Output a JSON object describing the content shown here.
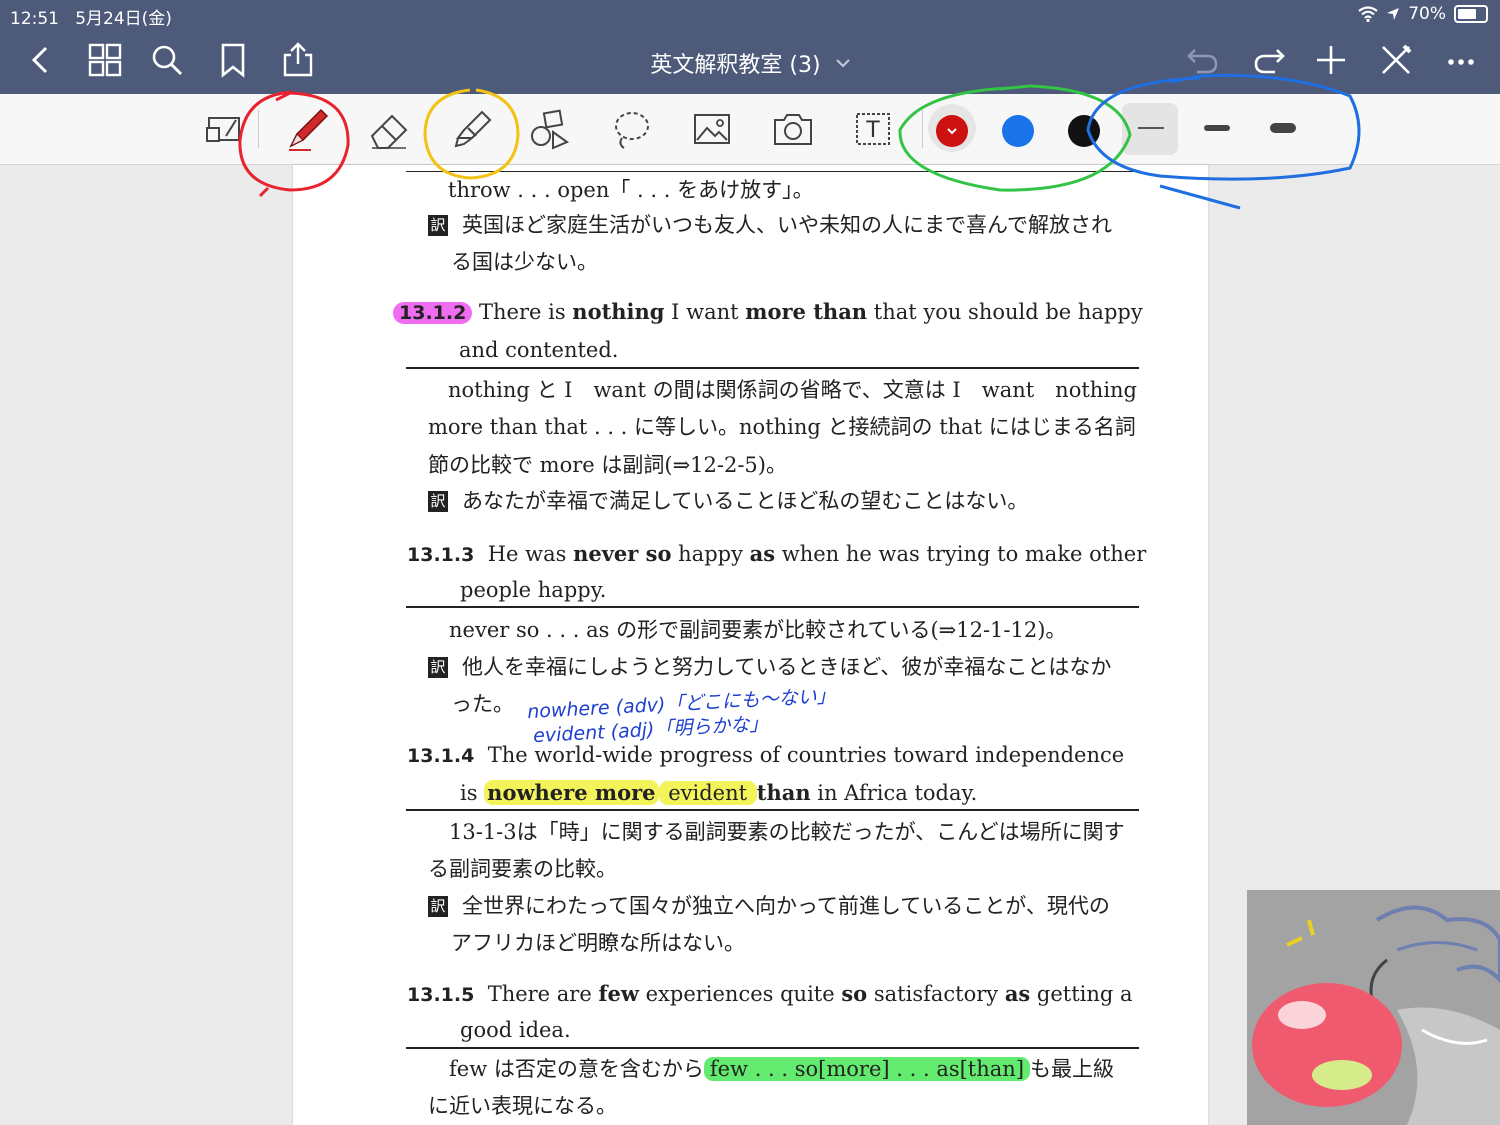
{
  "status_bar": {
    "time": "12:51",
    "date": "5月24日(金)",
    "battery": "70%"
  },
  "nav": {
    "title": "英文解釈教室 (3)",
    "left_icons": [
      "back-icon",
      "grid-icon",
      "search-icon",
      "bookmark-icon",
      "share-icon"
    ],
    "right_icons": [
      "undo-icon",
      "redo-icon",
      "add-icon",
      "close-pen-icon",
      "more-icon"
    ]
  },
  "toolbar": {
    "tools": [
      "zoom-window-tool",
      "pen-tool",
      "eraser-tool",
      "highlighter-tool",
      "shapes-tool",
      "lasso-tool",
      "image-tool",
      "camera-tool",
      "text-tool"
    ],
    "text_tool_glyph": "T",
    "colors": [
      "#cc1111",
      "#1a73e8",
      "#111111"
    ],
    "selected_color": "#cc1111",
    "stroke_widths": [
      "thin",
      "medium",
      "thick"
    ],
    "selected_stroke": "thin"
  },
  "annotation_colors": {
    "red": "#e8232e",
    "yellow": "#f2c214",
    "green": "#34c445",
    "blue": "#1f6fe0"
  },
  "page": {
    "top_line": "throw . . . open「 . . . をあけ放す」。",
    "s1_trans_a": "英国ほど家庭生活がいつも友人、いや未知の人にまで喜んで解放され",
    "s1_trans_b": "る国は少ない。",
    "yaku_label": "訳",
    "s2": {
      "num": "13.1.2",
      "text_a": "There is ",
      "bold_a": "nothing",
      "text_b": " I want ",
      "bold_b": "more than",
      "text_c": " that you should be happy",
      "line2": "and contented.",
      "note1": "nothing と I　want の間は関係詞の省略で、文意は I　want　nothing",
      "note2": "more than that . . . に等しい。nothing と接続詞の that にはじまる名詞",
      "note3": "節の比較で more は副詞(⇒12-2-5)。",
      "trans": "あなたが幸福で満足していることほど私の望むことはない。"
    },
    "s3": {
      "num": "13.1.3",
      "text_a": "He was ",
      "bold_a": "never so",
      "text_b": " happy ",
      "bold_b": "as",
      "text_c": " when he was trying to make other",
      "line2": "people happy.",
      "note1": "never so . . . as の形で副詞要素が比較されている(⇒12-1-12)。",
      "trans_a": "他人を幸福にしようと努力しているときほど、彼が幸福なことはなか",
      "trans_b": "った。"
    },
    "handwritten": {
      "line1": "nowhere (adv)「どこにも〜ない」",
      "line2": "evident (adj)「明らかな」"
    },
    "s4": {
      "num": "13.1.4",
      "line1": "The world-wide progress of countries toward independence",
      "text_is": "is ",
      "bold_a": "nowhere more",
      "text_b": " evident ",
      "bold_b": "than",
      "text_c": " in Africa today.",
      "note1": "13-1-3は「時」に関する副詞要素の比較だったが、こんどは場所に関す",
      "note2": "る副詞要素の比較。",
      "trans_a": "全世界にわたって国々が独立へ向かって前進していることが、現代の",
      "trans_b": "アフリカほど明瞭な所はない。"
    },
    "s5": {
      "num": "13.1.5",
      "text_a": "There are ",
      "bold_a": "few",
      "text_b": " experiences quite ",
      "bold_b": "so",
      "text_c": " satisfactory ",
      "bold_c": "as",
      "text_d": " getting a",
      "line2": "good idea.",
      "note_a": "few は否定の意を含むから",
      "note_hl": "few . . . so[more] . . . as[than]",
      "note_b": "も最上級",
      "note2": "に近い表現になる。"
    }
  }
}
